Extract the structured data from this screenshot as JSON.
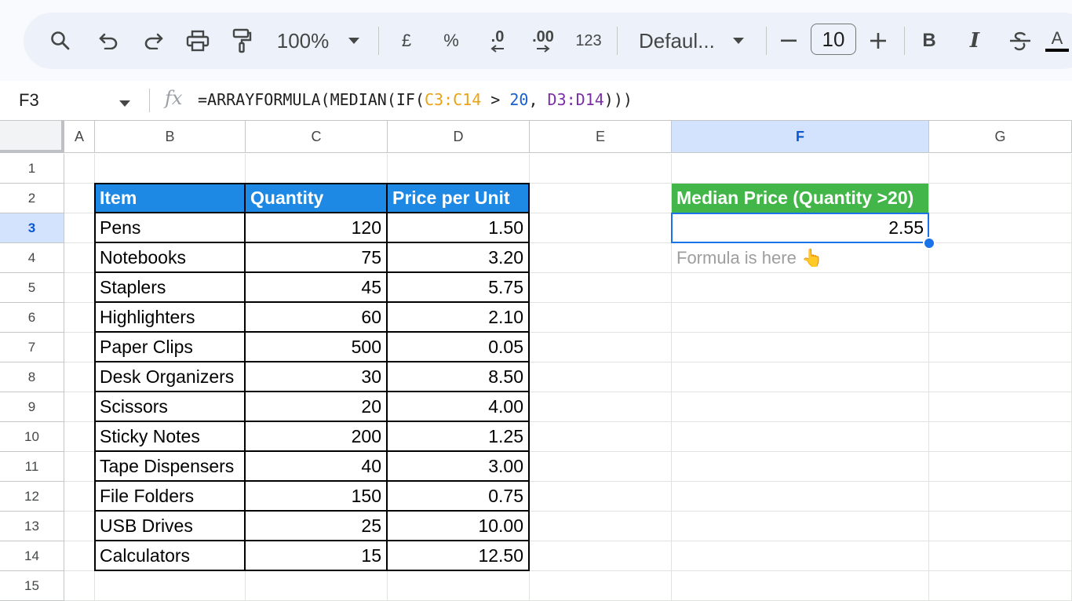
{
  "toolbar": {
    "zoom": "100%",
    "currency": "£",
    "percent": "%",
    "decrease_decimal": ".0",
    "increase_decimal": ".00",
    "number_format": "123",
    "font": "Defaul...",
    "font_size": "10",
    "text_color_label": "A"
  },
  "formula_bar": {
    "cell_ref": "F3",
    "fx": "fx",
    "formula_parts": [
      "=ARRAYFORMULA(MEDIAN(IF(",
      "C3:C14",
      " > ",
      "20",
      ", ",
      "D3:D14",
      ")))"
    ]
  },
  "columns": [
    "A",
    "B",
    "C",
    "D",
    "E",
    "F",
    "G"
  ],
  "rows": [
    "1",
    "2",
    "3",
    "4",
    "5",
    "6",
    "7",
    "8",
    "9",
    "10",
    "11",
    "12",
    "13",
    "14",
    "15"
  ],
  "table": {
    "headers": [
      "Item",
      "Quantity",
      "Price per Unit"
    ],
    "rows": [
      [
        "Pens",
        "120",
        "1.50"
      ],
      [
        "Notebooks",
        "75",
        "3.20"
      ],
      [
        "Staplers",
        "45",
        "5.75"
      ],
      [
        "Highlighters",
        "60",
        "2.10"
      ],
      [
        "Paper Clips",
        "500",
        "0.05"
      ],
      [
        "Desk Organizers",
        "30",
        "8.50"
      ],
      [
        "Scissors",
        "20",
        "4.00"
      ],
      [
        "Sticky Notes",
        "200",
        "1.25"
      ],
      [
        "Tape Dispensers",
        "40",
        "3.00"
      ],
      [
        "File Folders",
        "150",
        "0.75"
      ],
      [
        "USB Drives",
        "25",
        "10.00"
      ],
      [
        "Calculators",
        "15",
        "12.50"
      ]
    ]
  },
  "result": {
    "header": "Median Price (Quantity >20)",
    "value": "2.55",
    "note": "Formula is here 👆"
  },
  "colors": {
    "table_header": "#1e88e5",
    "result_header": "#43b649",
    "selection": "#1a73e8"
  }
}
